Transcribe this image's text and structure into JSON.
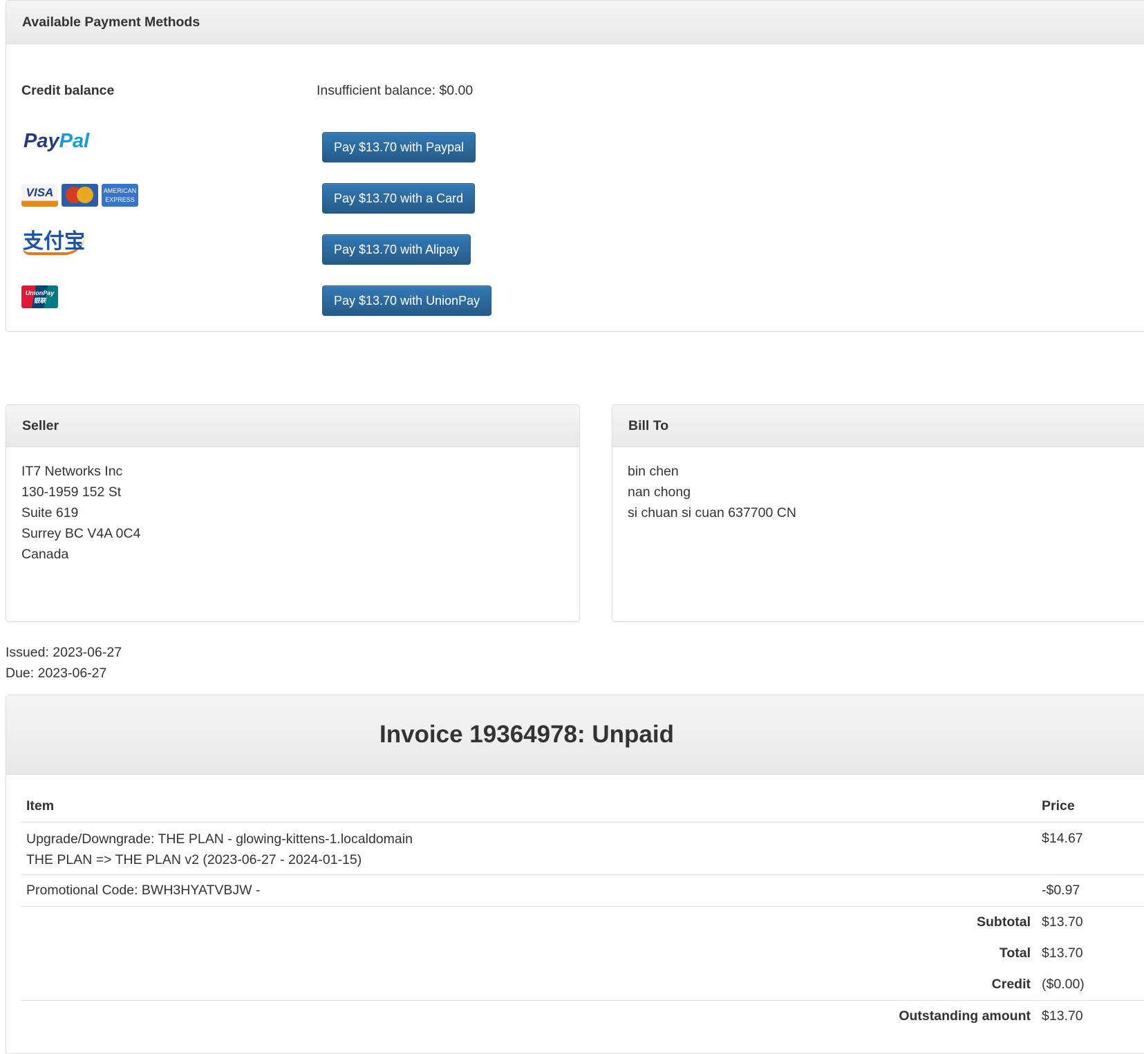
{
  "payment": {
    "title": "Available Payment Methods",
    "credit_label": "Credit balance",
    "credit_status": "Insufficient balance: $0.00",
    "methods": [
      {
        "logo": "PayPal",
        "button": "Pay $13.70 with Paypal"
      },
      {
        "logo": "VISA / MasterCard / American Express",
        "button": "Pay $13.70 with a Card"
      },
      {
        "logo": "支付宝",
        "button": "Pay $13.70 with Alipay"
      },
      {
        "logo": "UnionPay 银联",
        "button": "Pay $13.70 with UnionPay"
      }
    ]
  },
  "seller": {
    "title": "Seller",
    "lines": [
      "IT7 Networks Inc",
      "130-1959 152 St",
      "Suite 619",
      "Surrey BC V4A 0C4",
      "Canada"
    ]
  },
  "bill_to": {
    "title": "Bill To",
    "lines": [
      "bin chen",
      "nan chong",
      "si chuan si cuan 637700 CN"
    ]
  },
  "dates": {
    "issued": "Issued: 2023-06-27",
    "due": "Due: 2023-06-27"
  },
  "invoice": {
    "title": "Invoice 19364978: Unpaid",
    "col_item": "Item",
    "col_price": "Price",
    "items": [
      {
        "line1": "Upgrade/Downgrade: THE PLAN - glowing-kittens-1.localdomain",
        "line2": "THE PLAN => THE PLAN v2 (2023-06-27 - 2024-01-15)",
        "price": "$14.67"
      },
      {
        "line1": "Promotional Code: BWH3HYATVBJW -",
        "price": "-$0.97"
      }
    ],
    "totals": [
      {
        "label": "Subtotal",
        "value": "$13.70"
      },
      {
        "label": "Total",
        "value": "$13.70"
      },
      {
        "label": "Credit",
        "value": "($0.00)"
      },
      {
        "label": "Outstanding amount",
        "value": "$13.70"
      }
    ]
  },
  "colors": {
    "button": "#337ab7",
    "text": "#333333"
  }
}
